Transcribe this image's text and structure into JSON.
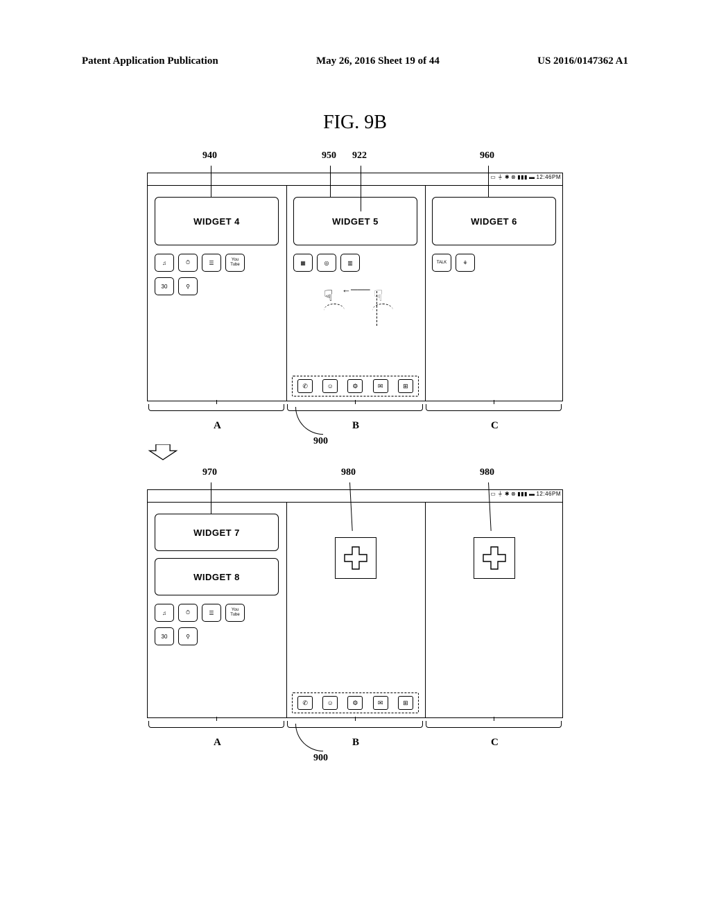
{
  "header": {
    "left": "Patent Application Publication",
    "center": "May 26, 2016  Sheet 19 of 44",
    "right": "US 2016/0147362 A1"
  },
  "figure_title": "FIG.  9B",
  "status_bar": {
    "time": "12:46PM"
  },
  "state1": {
    "refs": {
      "r940": "940",
      "r950": "950",
      "r922": "922",
      "r960": "960"
    },
    "panelA": {
      "widget": "WIDGET 4",
      "row1": [
        "♫",
        "⏱",
        "☰",
        "You\nTube"
      ],
      "row2": [
        "30",
        "⚲"
      ]
    },
    "panelB": {
      "widget": "WIDGET 5",
      "row": [
        "▦",
        "◎",
        "▥"
      ],
      "dock": [
        "✆",
        "☺",
        "⚙",
        "✉",
        "⊞"
      ]
    },
    "panelC": {
      "widget": "WIDGET 6",
      "row": [
        "TALK",
        "⚘"
      ]
    },
    "brackets": {
      "a": "A",
      "b": "B",
      "c": "C"
    },
    "label900": "900"
  },
  "state2": {
    "refs": {
      "r970": "970",
      "r980a": "980",
      "r980b": "980"
    },
    "panelA": {
      "widget7": "WIDGET 7",
      "widget8": "WIDGET 8",
      "row1": [
        "♫",
        "⏱",
        "☰",
        "You\nTube"
      ],
      "row2": [
        "30",
        "⚲"
      ]
    },
    "panelB": {
      "dock": [
        "✆",
        "☺",
        "⚙",
        "✉",
        "⊞"
      ]
    },
    "brackets": {
      "a": "A",
      "b": "B",
      "c": "C"
    },
    "label900": "900"
  }
}
